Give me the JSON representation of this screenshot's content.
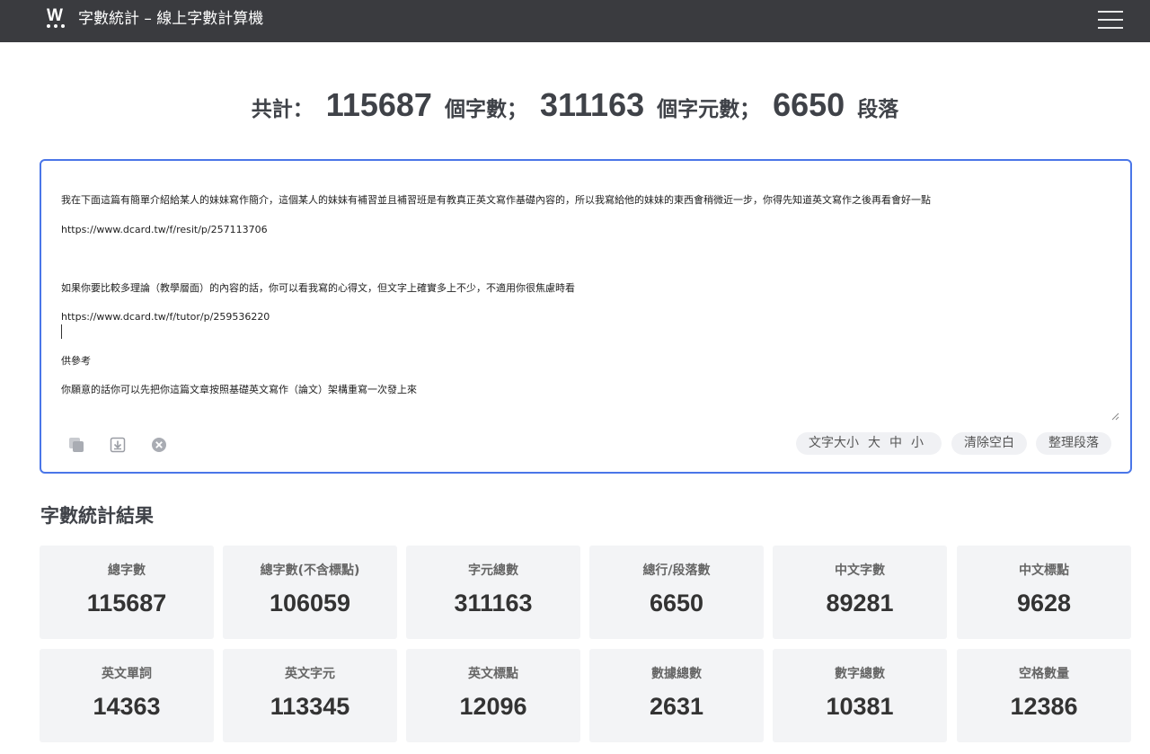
{
  "header": {
    "logo_letter": "W",
    "title": "字數統計 – 線上字數計算機",
    "menu_icon": "hamburger-menu-icon"
  },
  "summary": {
    "prefix": "共計：",
    "words": "115687",
    "words_label": "個字數；",
    "chars": "311163",
    "chars_label": "個字元數；",
    "paragraphs": "6650",
    "paragraphs_label": "段落"
  },
  "editor": {
    "lines": [
      "我在下面這篇有簡單介紹給某人的妹妹寫作簡介，這個某人的妹妹有補習並且補習班是有教真正英文寫作基礎內容的，所以我寫給他的妹妹的東西會稍微近一步，你得先知道英文寫作之後再看會好一點",
      "https://www.dcard.tw/f/resit/p/257113706",
      "",
      "如果你要比較多理論（教學層面）的內容的話，你可以看我寫的心得文，但文字上確實多上不少，不適用你很焦慮時看",
      "https://www.dcard.tw/f/tutor/p/259536220",
      "",
      "供參考",
      "你願意的話你可以先把你這篇文章按照基礎英文寫作（論文）架構重寫一次發上來"
    ],
    "toolbar": {
      "copy_icon": "copy-icon",
      "download_icon": "download-icon",
      "clear_icon": "clear-circle-x-icon",
      "font_size_label": "文字大小",
      "size_large": "大",
      "size_medium": "中",
      "size_small": "小",
      "remove_spaces": "清除空白",
      "tidy_paragraphs": "整理段落"
    }
  },
  "results": {
    "title": "字數統計結果",
    "cards": [
      {
        "label": "總字數",
        "value": "115687"
      },
      {
        "label": "總字數(不含標點)",
        "value": "106059"
      },
      {
        "label": "字元總數",
        "value": "311163"
      },
      {
        "label": "總行/段落數",
        "value": "6650"
      },
      {
        "label": "中文字數",
        "value": "89281"
      },
      {
        "label": "中文標點",
        "value": "9628"
      },
      {
        "label": "英文單詞",
        "value": "14363"
      },
      {
        "label": "英文字元",
        "value": "113345"
      },
      {
        "label": "英文標點",
        "value": "12096"
      },
      {
        "label": "數據總數",
        "value": "2631"
      },
      {
        "label": "數字總數",
        "value": "10381"
      },
      {
        "label": "空格數量",
        "value": "12386"
      }
    ]
  },
  "colors": {
    "topbar": "#3a3b3f",
    "editor_border": "#4a76e8",
    "card_bg": "#f3f4f6"
  }
}
